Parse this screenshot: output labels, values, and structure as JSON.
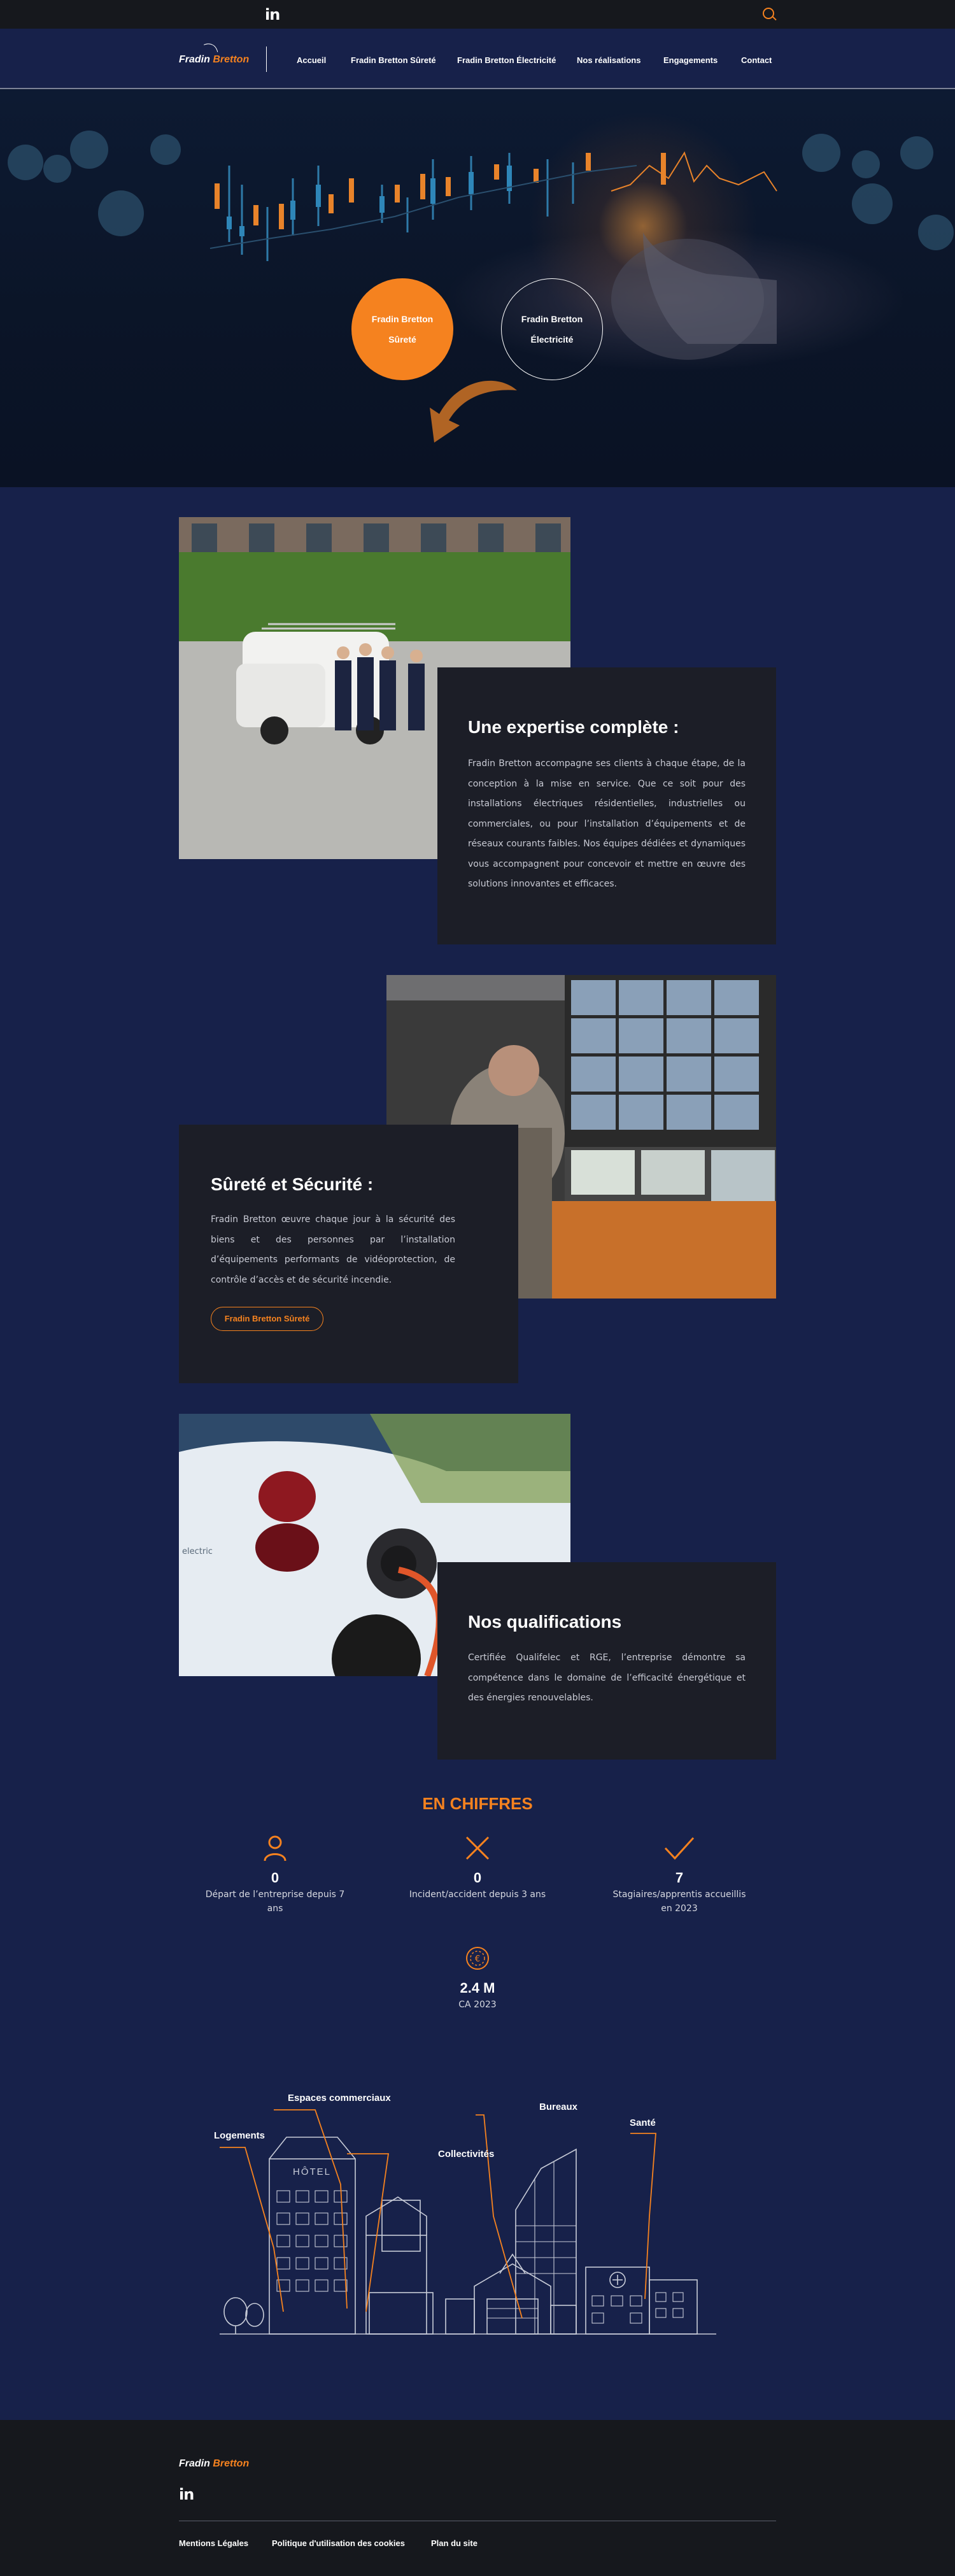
{
  "topbar": {
    "linkedin_label": "in"
  },
  "header": {
    "logo": {
      "part1": "Fradin",
      "part2": "Bretton"
    },
    "nav": [
      "Accueil",
      "Fradin Bretton Sûreté",
      "Fradin Bretton Électricité",
      "Nos réalisations",
      "Engagements",
      "Contact"
    ]
  },
  "hero": {
    "circles": [
      {
        "line1": "Fradin Bretton",
        "line2": "Sûreté"
      },
      {
        "line1": "Fradin Bretton",
        "line2": "Électricité"
      }
    ]
  },
  "sections": [
    {
      "title": "Une expertise complète :",
      "text": "Fradin Bretton accompagne ses clients à chaque étape, de la conception à la mise en service. Que ce soit pour des installations électriques résidentielles, industrielles ou commerciales, ou pour l’installation d’équipements et de réseaux courants faibles. Nos équipes dédiées et dynamiques vous accompagnent pour concevoir et mettre en œuvre des solutions innovantes et efficaces."
    },
    {
      "title": "Sûreté et Sécurité :",
      "text": "Fradin Bretton œuvre chaque jour à la sécurité des biens et des personnes par l’installation d’équipements performants de vidéoprotection, de contrôle d’accès et de sécurité incendie.",
      "button": "Fradin Bretton Sûreté"
    },
    {
      "title": "Nos qualifications",
      "text": "Certifiée Qualifelec et RGE, l’entreprise démontre sa compétence dans le domaine de l’efficacité énergétique et des énergies renouvelables."
    }
  ],
  "figures": {
    "title": "EN CHIFFRES",
    "items": [
      {
        "icon": "person-icon",
        "value": "0",
        "label": "Départ de l’entreprise depuis 7 ans"
      },
      {
        "icon": "cross-icon",
        "value": "0",
        "label": "Incident/accident depuis 3 ans"
      },
      {
        "icon": "check-icon",
        "value": "7",
        "label": "Stagiaires/apprentis accueillis en 2023"
      },
      {
        "icon": "euro-coin-icon",
        "value": "2.4 M",
        "label": "CA 2023"
      }
    ]
  },
  "illustration": {
    "labels": [
      "Espaces commerciaux",
      "Logements",
      "Collectivités",
      "Bureaux",
      "Santé"
    ],
    "hotel_sign": "HÔTEL",
    "accent": "#f5821f"
  },
  "footer": {
    "logo": {
      "part1": "Fradin",
      "part2": "Bretton"
    },
    "linkedin_label": "in",
    "links": [
      "Mentions Légales",
      "Politique d'utilisation des cookies",
      "Plan du site"
    ]
  },
  "colors": {
    "accent": "#f5821f",
    "background": "#17214a",
    "card": "#1c1e27",
    "footer": "#16181d"
  }
}
